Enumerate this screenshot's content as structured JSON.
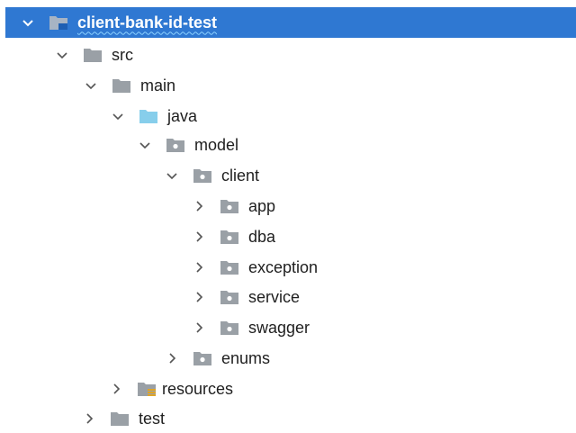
{
  "project": {
    "name": "client-bank-id-test",
    "expanded": true,
    "selected": true
  },
  "tree": [
    {
      "id": "src",
      "label": "src",
      "expanded": true,
      "icon": "folder-icon"
    },
    {
      "id": "main",
      "label": "main",
      "expanded": true,
      "icon": "folder-icon"
    },
    {
      "id": "java",
      "label": "java",
      "expanded": true,
      "icon": "source-root-folder-icon"
    },
    {
      "id": "model",
      "label": "model",
      "expanded": true,
      "icon": "package-icon"
    },
    {
      "id": "client",
      "label": "client",
      "expanded": true,
      "icon": "package-icon"
    },
    {
      "id": "app",
      "label": "app",
      "expanded": false,
      "icon": "package-icon"
    },
    {
      "id": "dba",
      "label": "dba",
      "expanded": false,
      "icon": "package-icon"
    },
    {
      "id": "exception",
      "label": "exception",
      "expanded": false,
      "icon": "package-icon"
    },
    {
      "id": "service",
      "label": "service",
      "expanded": false,
      "icon": "package-icon"
    },
    {
      "id": "swagger",
      "label": "swagger",
      "expanded": false,
      "icon": "package-icon"
    },
    {
      "id": "enums",
      "label": "enums",
      "expanded": false,
      "icon": "package-icon"
    },
    {
      "id": "resources",
      "label": "resources",
      "expanded": false,
      "icon": "resources-folder-icon"
    },
    {
      "id": "test",
      "label": "test",
      "expanded": false,
      "icon": "folder-icon"
    }
  ],
  "colors": {
    "selection": "#2f78d2",
    "folder": "#9aa0a6",
    "source_root": "#87ceeb",
    "resources_stripes": "#e0a526"
  }
}
